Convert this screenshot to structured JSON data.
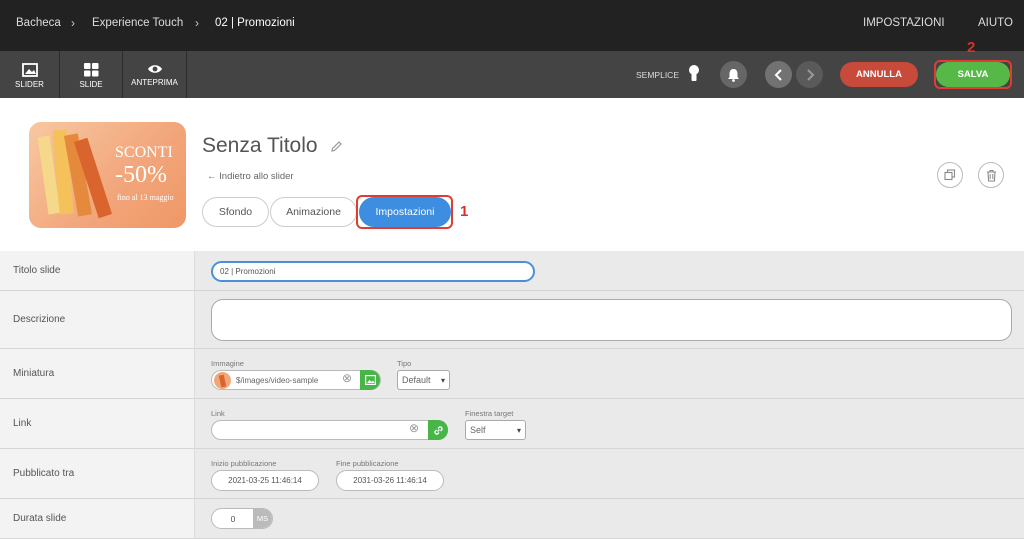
{
  "breadcrumb": {
    "items": [
      "Bacheca",
      "Experience Touch",
      "02 | Promozioni"
    ]
  },
  "top_menu": {
    "settings": "IMPOSTAZIONI",
    "help": "AIUTO"
  },
  "toolbar": {
    "tools": [
      {
        "label": "SLIDER",
        "icon": "image-icon"
      },
      {
        "label": "SLIDE",
        "icon": "grid-icon"
      },
      {
        "label": "ANTEPRIMA",
        "icon": "eye-icon"
      }
    ],
    "mode_label": "SEMPLICE",
    "cancel_label": "ANNULLA",
    "save_label": "SALVA",
    "colors": {
      "cancel": "#c74a3a",
      "save": "#56b947",
      "annotation": "#e03c31",
      "active_tab": "#3d8ee0"
    }
  },
  "annotations": {
    "first": "1",
    "second": "2"
  },
  "slide": {
    "thumbnail": {
      "line1": "SCONTI",
      "line2": "-50%",
      "line3": "fino al 13 maggio"
    },
    "title": "Senza Titolo",
    "back_link": "Indietro allo slider",
    "tabs": [
      "Sfondo",
      "Animazione",
      "Impostazioni"
    ],
    "active_tab": "Impostazioni"
  },
  "form": {
    "title": {
      "label": "Titolo slide",
      "value": "02 | Promozioni"
    },
    "description": {
      "label": "Descrizione",
      "value": ""
    },
    "thumbnail": {
      "label": "Miniatura",
      "image_label": "Immagine",
      "image_value": "$/images/video-sample",
      "type_label": "Tipo",
      "type_value": "Default"
    },
    "link": {
      "label": "Link",
      "link_label": "Link",
      "link_value": "",
      "target_label": "Finestra target",
      "target_value": "Self"
    },
    "published": {
      "label": "Pubblicato tra",
      "start_label": "Inizio pubblicazione",
      "start_value": "2021-03-25 11:46:14",
      "end_label": "Fine pubblicazione",
      "end_value": "2031-03-26 11:46:14"
    },
    "duration": {
      "label": "Durata slide",
      "value": "0",
      "unit": "MS"
    }
  }
}
